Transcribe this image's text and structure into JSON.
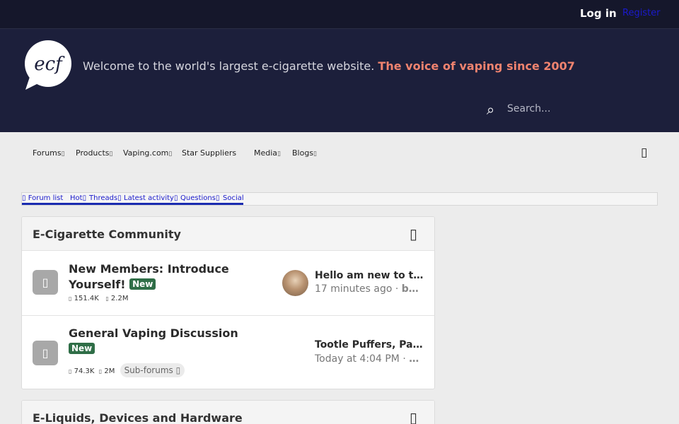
{
  "topbar": {
    "login_label": "Log in",
    "register_label": "Register"
  },
  "header": {
    "logo_text": "ecf",
    "tagline": "Welcome to the world's largest e-cigarette website.",
    "tagline_highlight": "The voice of vaping since 2007",
    "highlight_color": "#f0836f",
    "search": {
      "placeholder": "Search...",
      "icon": "search-icon"
    }
  },
  "nav": {
    "items": [
      "Forums",
      "Products",
      "Vaping.com",
      "Star Suppliers",
      "Media",
      "Blogs"
    ],
    "dropdown_glyph": "▯",
    "menu_icon": "menu-icon"
  },
  "tabs": {
    "items": [
      "Forum list",
      "Hot",
      "Threads",
      "Latest activity",
      "Questions",
      "Social"
    ],
    "glyph": "▯"
  },
  "sections": [
    {
      "title": "E-Cigarette Community",
      "collapse_glyph": "▯",
      "forums": [
        {
          "title": "New Members: Introduce Yourself!",
          "badge": "New",
          "threads": "151.4K",
          "messages": "2.2M",
          "latest_title": "Hello am new to t…",
          "latest_time": "17 minutes ago",
          "latest_author": "b…"
        },
        {
          "title": "General Vaping Discussion",
          "badge": "New",
          "threads": "74.3K",
          "messages": "2M",
          "subforums_label": "Sub-forums",
          "latest_title": "Tootle Puffers, Pa…",
          "latest_time": "Today at 4:04 PM",
          "latest_author": "…"
        }
      ]
    },
    {
      "title": "E-Liquids, Devices and Hardware",
      "collapse_glyph": "▯"
    }
  ],
  "meta_separator": "·",
  "icon_glyph": "▯"
}
